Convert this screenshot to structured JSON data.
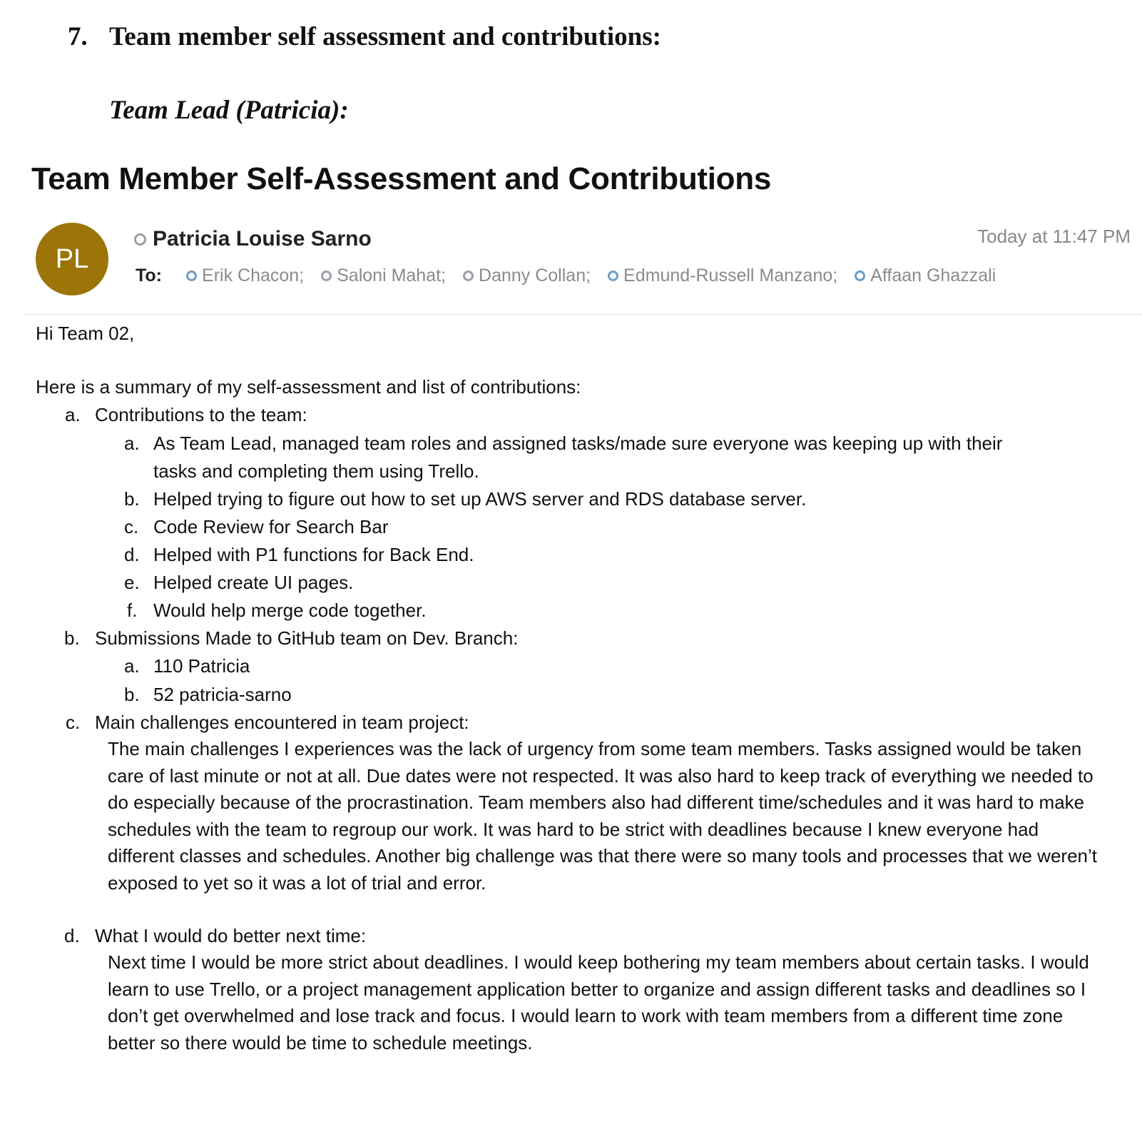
{
  "document": {
    "section_number": "7.",
    "section_title": "Team member self assessment and contributions:",
    "subheading": "Team Lead (Patricia):"
  },
  "email": {
    "subject": "Team Member Self-Assessment and Contributions",
    "avatar_initials": "PL",
    "avatar_color": "#9c7408",
    "sender": "Patricia Louise Sarno",
    "timestamp": "Today at 11:47 PM",
    "to_label": "To:",
    "recipients": [
      "Erik Chacon;",
      "Saloni Mahat;",
      "Danny Collan;",
      "Edmund-Russell Manzano;",
      "Affaan Ghazzali"
    ]
  },
  "body": {
    "greeting": "Hi Team 02,",
    "intro": "Here is a summary of my self-assessment and list of contributions:",
    "sections": [
      {
        "marker": "a.",
        "title": "Contributions to the team:",
        "items": [
          {
            "marker": "a.",
            "lines": [
              "As Team Lead, managed team roles and assigned tasks/made sure everyone was keeping up with their",
              "tasks and completing them using Trello."
            ]
          },
          {
            "marker": "b.",
            "lines": [
              "Helped trying to figure out how to set up AWS server and RDS database server."
            ]
          },
          {
            "marker": "c.",
            "lines": [
              "Code Review for Search Bar"
            ]
          },
          {
            "marker": "d.",
            "lines": [
              "Helped with P1 functions for Back End."
            ]
          },
          {
            "marker": "e.",
            "lines": [
              "Helped create UI pages."
            ]
          },
          {
            "marker": "f.",
            "lines": [
              "Would help merge code together."
            ]
          }
        ]
      },
      {
        "marker": "b.",
        "title": "Submissions Made to GitHub team on Dev. Branch:",
        "items": [
          {
            "marker": "a.",
            "lines": [
              "110  Patricia"
            ]
          },
          {
            "marker": "b.",
            "lines": [
              "52  patricia-sarno"
            ]
          }
        ]
      },
      {
        "marker": "c.",
        "title": "Main challenges encountered in team project:",
        "paragraph": "The main challenges I experiences was the lack of urgency from some team members. Tasks assigned would be taken care of last minute or not at all. Due dates were not respected. It was also hard to keep track of everything we needed to do especially because of the procrastination. Team members also had different time/schedules and it was hard to make schedules with the team to regroup our work. It was hard to be strict with deadlines because I knew everyone had different classes and schedules. Another big challenge was that there were so many tools and processes that we weren’t exposed to yet so it was a lot of trial and error."
      },
      {
        "marker": "d.",
        "title": "What I would do better next time:",
        "paragraph": "Next time I would be more strict about deadlines. I would keep bothering my team members about certain tasks. I would learn to use Trello, or a project management application better to organize and assign different tasks and deadlines so I don’t get overwhelmed and lose track and focus. I would learn to work with team members from a different time zone better so there would be time to schedule meetings."
      }
    ]
  }
}
